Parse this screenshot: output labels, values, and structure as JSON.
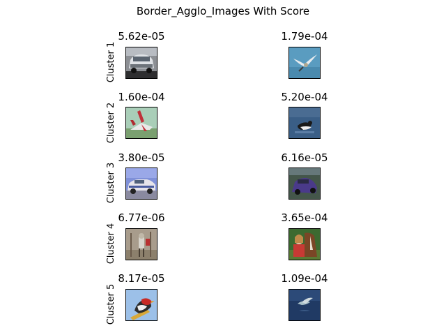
{
  "figure": {
    "title": "Border_Agglo_Images With Score"
  },
  "clusters": [
    {
      "label": "Cluster 1",
      "images": [
        {
          "score": "5.62e-05",
          "icon": "car-photo"
        },
        {
          "score": "1.79e-04",
          "icon": "bird-in-flight-photo"
        }
      ]
    },
    {
      "label": "Cluster 2",
      "images": [
        {
          "score": "1.60e-04",
          "icon": "airplane-photo"
        },
        {
          "score": "5.20e-04",
          "icon": "bird-on-water-photo"
        }
      ]
    },
    {
      "label": "Cluster 3",
      "images": [
        {
          "score": "3.80e-05",
          "icon": "police-car-photo"
        },
        {
          "score": "6.16e-05",
          "icon": "purple-car-photo"
        }
      ]
    },
    {
      "label": "Cluster 4",
      "images": [
        {
          "score": "6.77e-06",
          "icon": "deer-photo"
        },
        {
          "score": "3.65e-04",
          "icon": "horse-and-person-photo"
        }
      ]
    },
    {
      "label": "Cluster 5",
      "images": [
        {
          "score": "8.17e-05",
          "icon": "red-bird-photo"
        },
        {
          "score": "1.09e-04",
          "icon": "gull-over-water-photo"
        }
      ]
    }
  ]
}
